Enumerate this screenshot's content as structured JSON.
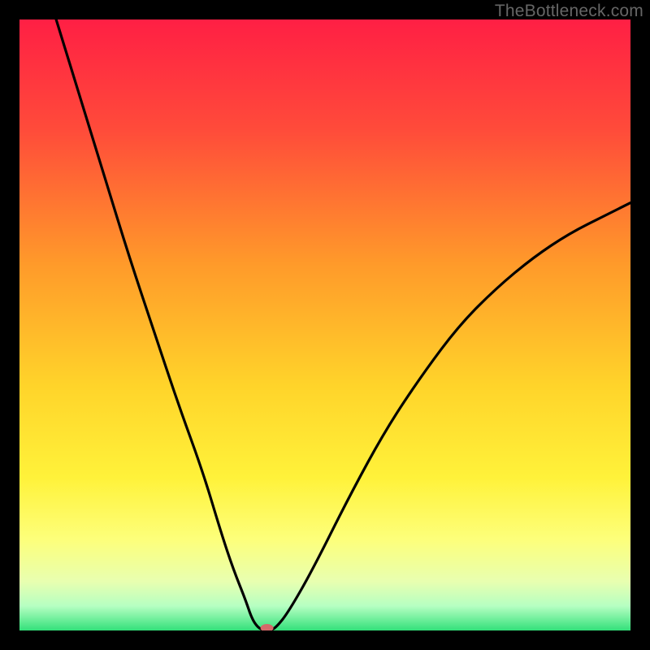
{
  "watermark": "TheBottleneck.com",
  "chart_data": {
    "type": "line",
    "title": "",
    "xlabel": "",
    "ylabel": "",
    "xlim": [
      0,
      100
    ],
    "ylim": [
      0,
      100
    ],
    "grid": false,
    "legend": false,
    "background_gradient": {
      "stops": [
        {
          "offset": 0,
          "color": "#ff1f44"
        },
        {
          "offset": 18,
          "color": "#ff4b3a"
        },
        {
          "offset": 40,
          "color": "#ff9a2a"
        },
        {
          "offset": 60,
          "color": "#ffd42a"
        },
        {
          "offset": 75,
          "color": "#fff23a"
        },
        {
          "offset": 85,
          "color": "#fdff7a"
        },
        {
          "offset": 92,
          "color": "#e8ffb0"
        },
        {
          "offset": 96,
          "color": "#b6ffc2"
        },
        {
          "offset": 100,
          "color": "#33e07a"
        }
      ]
    },
    "series": [
      {
        "name": "bottleneck-curve",
        "color": "#000000",
        "x": [
          6,
          10,
          14,
          18,
          22,
          26,
          30,
          33,
          35,
          37,
          38,
          39,
          40,
          41,
          42,
          44,
          48,
          54,
          60,
          66,
          72,
          78,
          84,
          90,
          96,
          100
        ],
        "y": [
          100,
          87,
          74,
          61,
          49,
          37,
          26,
          16,
          10,
          5,
          2,
          0.5,
          0,
          0,
          0.5,
          3,
          10,
          22,
          33,
          42,
          50,
          56,
          61,
          65,
          68,
          70
        ]
      }
    ],
    "marker": {
      "name": "optimal-point",
      "x": 40.5,
      "y": 0,
      "color": "#d56a6a",
      "rx": 8,
      "ry": 5
    }
  }
}
